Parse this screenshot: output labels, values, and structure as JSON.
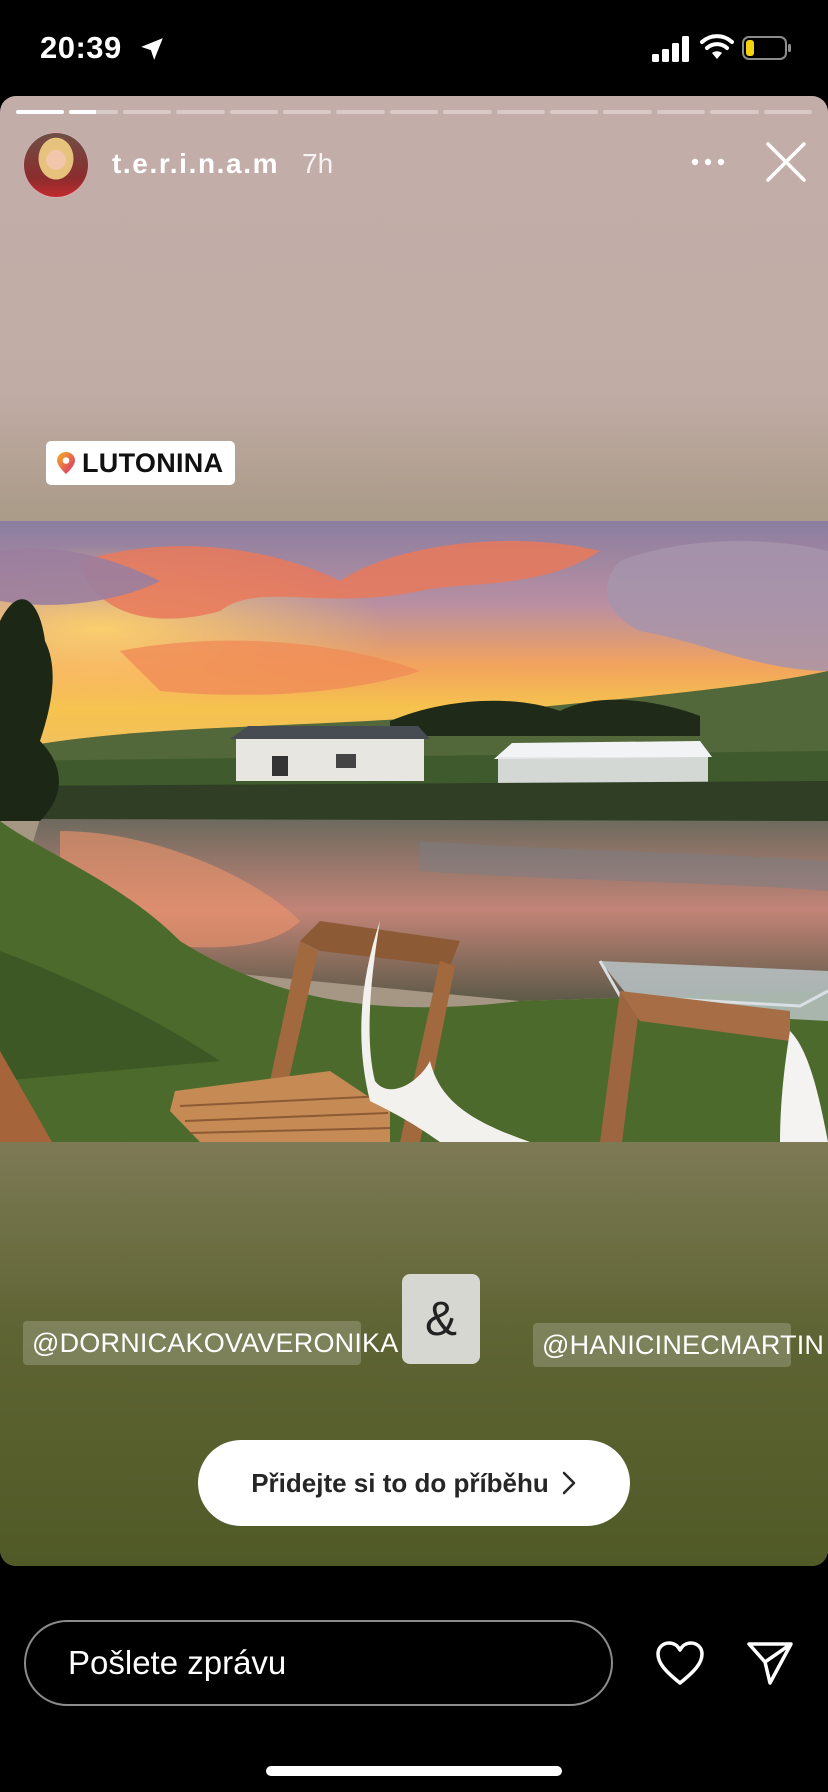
{
  "status_bar": {
    "time": "20:39"
  },
  "story": {
    "username": "t.e.r.i.n.a.m",
    "time_ago": "7h",
    "progress": {
      "segments": 15,
      "current_index": 1,
      "current_fraction": 0.55
    },
    "location_sticker": "LUTONINA",
    "mentions": [
      "@DORNICAKOVAVERONIKA",
      "@HANICINECMARTIN"
    ],
    "ampersand_sticker": "&",
    "add_to_story_label": "Přidejte si to do příběhu"
  },
  "message_bar": {
    "placeholder": "Pošlete zprávu"
  },
  "icons": {
    "location": "location-arrow-icon",
    "signal": "cellular-signal-icon",
    "wifi": "wifi-icon",
    "battery": "battery-low-icon",
    "more": "more-options-icon",
    "close": "close-icon",
    "pin": "location-pin-icon",
    "chevron": "chevron-right-icon",
    "like": "heart-icon",
    "send": "send-icon"
  },
  "colors": {
    "battery_level": "#f5d40f",
    "pin_gradient_start": "#f7b21e",
    "pin_gradient_end": "#d62976"
  }
}
